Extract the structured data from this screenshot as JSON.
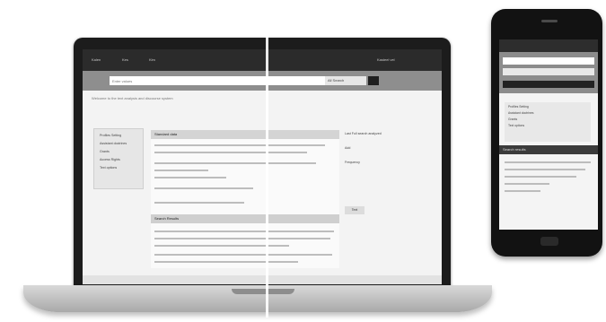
{
  "laptop": {
    "topbar_items": [
      "Kalen",
      "Kes",
      "Kim",
      "Kasteel vel"
    ],
    "search": {
      "placeholder": "Enter values"
    },
    "scope": "All Search",
    "breadcrumb": "Welcome to the text analysis and discourse system",
    "sidebar_items": [
      "Profiles Setting",
      "Assistant doctrines",
      "Grants",
      "Access Rights",
      "Text options"
    ],
    "panel_title": "Standard data",
    "panel_title2": "Search Results",
    "right_col": [
      "Last Full search analyzed",
      "Add",
      "Frequency"
    ],
    "right_button": "Text"
  },
  "phone": {
    "header": "Search results",
    "sidebar_items": [
      "Profiles Setting",
      "Assistant doctrines",
      "Grants",
      "Text options"
    ]
  },
  "colors": {
    "dark": "#1c1c1c",
    "band": "#8e8e8e",
    "screen": "#f3f3f3"
  }
}
